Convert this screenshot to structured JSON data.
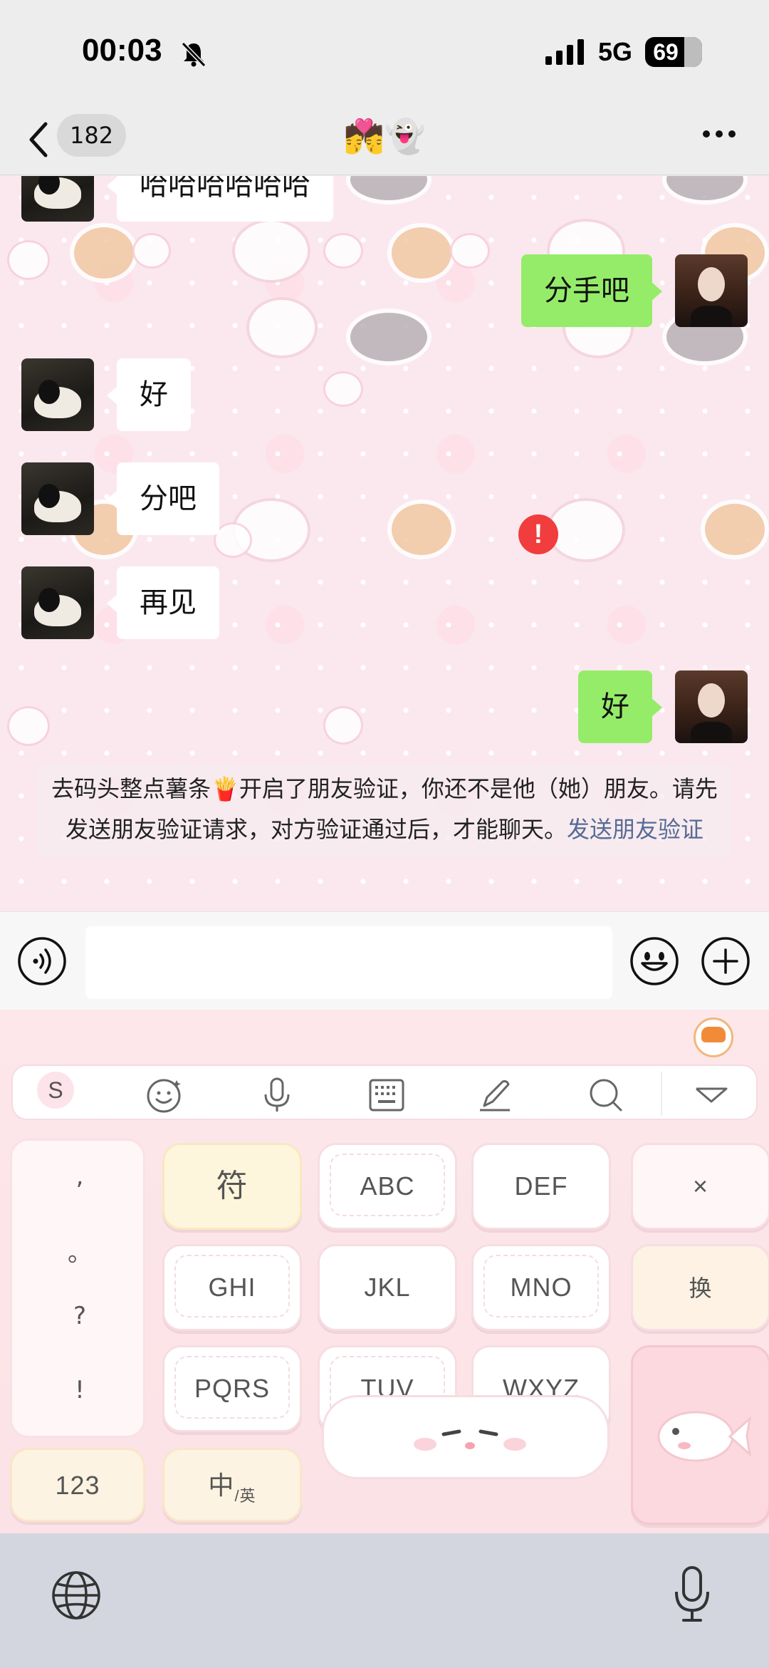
{
  "status_bar": {
    "time": "00:03",
    "network": "5G",
    "battery": "69",
    "battery_level": 69
  },
  "nav": {
    "unread_count": "182",
    "title": "💏👻"
  },
  "messages": [
    {
      "side": "in",
      "text": "哈哈哈哈哈哈"
    },
    {
      "side": "out",
      "text": "分手吧"
    },
    {
      "side": "in",
      "text": "好"
    },
    {
      "side": "in",
      "text": "分吧"
    },
    {
      "side": "in",
      "text": "再见"
    },
    {
      "side": "out",
      "text": "好",
      "failed": true,
      "error_mark": "!"
    }
  ],
  "notice": {
    "text": "去码头整点薯条🍟开启了朋友验证，你还不是他（她）朋友。请先发送朋友验证请求，对方验证通过后，才能聊天。",
    "link": "发送朋友验证"
  },
  "input": {
    "placeholder": ""
  },
  "keyboard": {
    "brand_letter": "S",
    "side_symbols": [
      ",",
      "。",
      "?",
      "!"
    ],
    "keys": {
      "symbols": "符",
      "abc": "ABC",
      "def": "DEF",
      "ghi": "GHI",
      "jkl": "JKL",
      "mno": "MNO",
      "pqrs": "PQRS",
      "tuv": "TUV",
      "wxyz": "WXYZ",
      "delete": "×",
      "switch": "换",
      "numbers": "123",
      "lang_main": "中",
      "lang_sub": "/英"
    }
  },
  "colors": {
    "outgoing_bubble": "#95ec69",
    "incoming_bubble": "#ffffff",
    "error": "#f13d3d",
    "link": "#576b95"
  }
}
